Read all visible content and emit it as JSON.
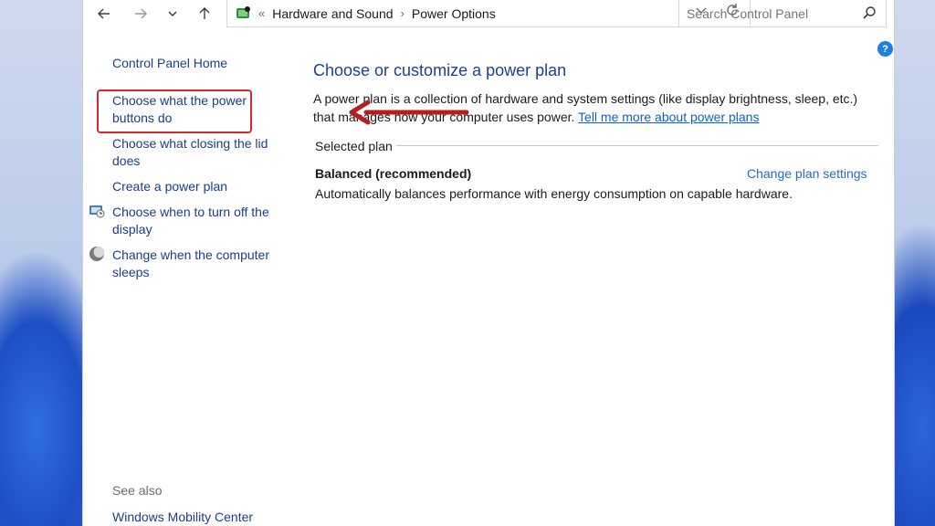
{
  "nav": {
    "back_icon": "back-arrow-icon",
    "forward_icon": "forward-arrow-icon",
    "recent_icon": "chevron-down-icon",
    "up_icon": "up-arrow-icon"
  },
  "address": {
    "overflow": "«",
    "crumbs": [
      "Hardware and Sound",
      "Power Options"
    ],
    "separator": "›"
  },
  "search": {
    "placeholder": "Search Control Panel"
  },
  "help": {
    "label": "?"
  },
  "sidebar": {
    "home": "Control Panel Home",
    "items": [
      "Choose what the power buttons do",
      "Choose what closing the lid does",
      "Create a power plan",
      "Choose when to turn off the display",
      "Change when the computer sleeps"
    ],
    "see_also": "See also",
    "see_also_items": [
      "Windows Mobility Center"
    ]
  },
  "main": {
    "title": "Choose or customize a power plan",
    "description": "A power plan is a collection of hardware and system settings (like display brightness, sleep, etc.) that manages how your computer uses power.",
    "link": "Tell me more about power plans",
    "selected_plan_label": "Selected plan",
    "plan_name": "Balanced (recommended)",
    "plan_settings_link": "Change plan settings",
    "plan_description": "Automatically balances performance with energy consumption on capable hardware."
  },
  "colors": {
    "accent": "#1d3f9a",
    "link": "#0b63c8",
    "highlight": "#d32a2a",
    "arrow": "#b51f1f"
  }
}
